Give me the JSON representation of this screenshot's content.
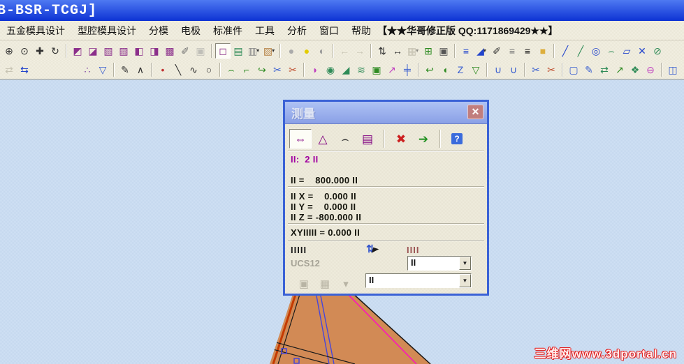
{
  "window": {
    "title": "B-BSR-TCGJ]"
  },
  "menu": {
    "items": [
      {
        "name": "menu-hardware-mold-design",
        "label": "五金模具设计"
      },
      {
        "name": "menu-cavity-mold-design",
        "label": "型腔模具设计"
      },
      {
        "name": "menu-parting",
        "label": "分模"
      },
      {
        "name": "menu-electrode",
        "label": "电极"
      },
      {
        "name": "menu-standard-parts",
        "label": "标准件"
      },
      {
        "name": "menu-tools",
        "label": "工具"
      },
      {
        "name": "menu-analysis",
        "label": "分析"
      },
      {
        "name": "menu-window",
        "label": "窗口"
      },
      {
        "name": "menu-help",
        "label": "帮助"
      }
    ],
    "banner": "【★★华哥修正版 QQ:1171869429★★】"
  },
  "toolbars": {
    "row1": [
      {
        "name": "zoom-window-icon",
        "glyph": "⊕",
        "color": "#303030"
      },
      {
        "name": "zoom-icon",
        "glyph": "⊙",
        "color": "#303030"
      },
      {
        "name": "pan-icon",
        "glyph": "✚",
        "color": "#303030"
      },
      {
        "name": "rotate-view-icon",
        "glyph": "↻",
        "color": "#303030"
      },
      {
        "sep": true
      },
      {
        "name": "shaded-view-icon",
        "glyph": "◩",
        "color": "#8B2F8B"
      },
      {
        "name": "isometric-view-icon",
        "glyph": "◪",
        "color": "#8B2F8B"
      },
      {
        "name": "trimetric-view-icon",
        "glyph": "▧",
        "color": "#8B2F8B"
      },
      {
        "name": "top-view-icon",
        "glyph": "▨",
        "color": "#8B2F8B"
      },
      {
        "name": "front-view-icon",
        "glyph": "◧",
        "color": "#8B2F8B"
      },
      {
        "name": "right-view-icon",
        "glyph": "◨",
        "color": "#8B2F8B"
      },
      {
        "name": "back-view-icon",
        "glyph": "▩",
        "color": "#8B2F8B"
      },
      {
        "name": "edit-view-icon",
        "glyph": "✐",
        "color": "#707070"
      },
      {
        "name": "lock-view-icon",
        "glyph": "▣",
        "color": "#9A9A9A",
        "grayed": true
      },
      {
        "sep": true
      },
      {
        "name": "shaded-display-icon",
        "glyph": "◻",
        "color": "#8B2F8B",
        "pressed": true
      },
      {
        "name": "wireframe-display-icon",
        "glyph": "▤",
        "color": "#2E8B57"
      },
      {
        "name": "hidden-edges-icon",
        "glyph": "▥",
        "color": "#8A8A8A",
        "dropdown": true
      },
      {
        "name": "section-display-icon",
        "glyph": "▧",
        "color": "#B8864B",
        "dropdown": true
      },
      {
        "sep": true
      },
      {
        "name": "highlight-off-icon",
        "glyph": "●",
        "color": "#AAAAAA"
      },
      {
        "name": "highlight-on-icon",
        "glyph": "●",
        "color": "#E3CC00"
      },
      {
        "name": "highlight-pick-icon",
        "glyph": "◐",
        "color": "#999999"
      },
      {
        "sep": true
      },
      {
        "name": "undo-view-icon",
        "glyph": "←",
        "color": "#A9A593",
        "grayed": true
      },
      {
        "name": "redo-view-icon",
        "glyph": "→",
        "color": "#A9A593",
        "grayed": true
      },
      {
        "sep": true
      },
      {
        "name": "swap-window-icon",
        "glyph": "⇅",
        "color": "#303030"
      },
      {
        "name": "measure-tool-icon",
        "glyph": "↔",
        "color": "#303030"
      },
      {
        "name": "pattern-icon",
        "glyph": "▦",
        "color": "#A9A593",
        "grayed": true,
        "dropdown": true
      },
      {
        "name": "new-part-icon",
        "glyph": "⊞",
        "color": "#2E8B22"
      },
      {
        "name": "part-navigator-icon",
        "glyph": "▣",
        "color": "#555555"
      },
      {
        "sep": true
      },
      {
        "name": "layer-settings-icon",
        "glyph": "≡",
        "color": "#2244CC"
      },
      {
        "name": "object-color-icon",
        "glyph": "◢",
        "color": "#2244CC",
        "dropdown": true
      },
      {
        "name": "eyedropper-icon",
        "glyph": "✐",
        "color": "#303030"
      },
      {
        "name": "line-style-icon",
        "glyph": "≡",
        "color": "#777777"
      },
      {
        "name": "line-width-icon",
        "glyph": "≡",
        "color": "#111111"
      },
      {
        "name": "material-icon",
        "glyph": "■",
        "color": "#DDAE3C"
      },
      {
        "sep": true
      },
      {
        "name": "line-tool-icon",
        "glyph": "╱",
        "color": "#2244CC"
      },
      {
        "name": "polyline-tool-icon",
        "glyph": "╱",
        "color": "#2E8B57"
      },
      {
        "name": "circle-tool-icon",
        "glyph": "◎",
        "color": "#2244CC"
      },
      {
        "name": "arc-tool-icon",
        "glyph": "⌢",
        "color": "#2E8B57"
      },
      {
        "name": "chamfer-tool-icon",
        "glyph": "▱",
        "color": "#2244CC"
      },
      {
        "name": "trim-tool-icon",
        "glyph": "✕",
        "color": "#2244CC"
      },
      {
        "name": "divide-tool-icon",
        "glyph": "⊘",
        "color": "#2E8B57"
      }
    ],
    "row2": [
      {
        "name": "transform-icon",
        "glyph": "⇄",
        "color": "#A9A593",
        "grayed": true
      },
      {
        "name": "reorder-icon",
        "glyph": "⇆",
        "color": "#2244CC"
      },
      {
        "gap": 68
      },
      {
        "name": "point-constructor-icon",
        "glyph": "∴",
        "color": "#7A3FA0"
      },
      {
        "name": "selection-filter-icon",
        "glyph": "▽",
        "color": "#3A5FD0"
      },
      {
        "sep": true
      },
      {
        "name": "sketch-icon",
        "glyph": "✎",
        "color": "#303030"
      },
      {
        "name": "profile-icon",
        "glyph": "∧",
        "color": "#303030"
      },
      {
        "sep": true
      },
      {
        "name": "point-icon",
        "glyph": "•",
        "color": "#C03030"
      },
      {
        "name": "line-icon",
        "glyph": "╲",
        "color": "#303030"
      },
      {
        "name": "spline-icon",
        "glyph": "∿",
        "color": "#303030"
      },
      {
        "name": "circle-icon",
        "glyph": "○",
        "color": "#303030"
      },
      {
        "sep": true
      },
      {
        "name": "bridge-curve-icon",
        "glyph": "⌢",
        "color": "#2E8B22"
      },
      {
        "name": "corner-curve-icon",
        "glyph": "⌐",
        "color": "#2E8B22"
      },
      {
        "name": "extend-curve-icon",
        "glyph": "↪",
        "color": "#2E8B22"
      },
      {
        "name": "trim-curve-icon",
        "glyph": "✂",
        "color": "#3A5FD0"
      },
      {
        "name": "break-curve-icon",
        "glyph": "✂",
        "color": "#C05030"
      },
      {
        "sep": true
      },
      {
        "name": "swept-surface-icon",
        "glyph": "◗",
        "color": "#C040C0"
      },
      {
        "name": "sphere-surface-icon",
        "glyph": "◉",
        "color": "#2E8B57"
      },
      {
        "name": "ruled-surface-icon",
        "glyph": "◢",
        "color": "#2E8B57"
      },
      {
        "name": "ripple-surface-icon",
        "glyph": "≋",
        "color": "#2E8B57"
      },
      {
        "name": "bounded-plane-icon",
        "glyph": "▣",
        "color": "#2E8B22"
      },
      {
        "name": "datum-axis-icon",
        "glyph": "↗",
        "color": "#C040C0"
      },
      {
        "name": "tube-icon",
        "glyph": "╪",
        "color": "#3A5FD0"
      },
      {
        "sep": true
      },
      {
        "name": "flange-icon",
        "glyph": "↩",
        "color": "#2E8B22"
      },
      {
        "name": "revolve-icon",
        "glyph": "◖",
        "color": "#2E8B22"
      },
      {
        "name": "loft-icon",
        "glyph": "Z",
        "color": "#3A5FD0"
      },
      {
        "name": "funnel-surface-icon",
        "glyph": "▽",
        "color": "#2E8B22"
      },
      {
        "sep": true
      },
      {
        "name": "shell-icon",
        "glyph": "∪",
        "color": "#3A5FD0"
      },
      {
        "name": "shell-pattern-icon",
        "glyph": "∪",
        "color": "#3A5FD0"
      },
      {
        "sep": true
      },
      {
        "name": "trim-sheet-icon",
        "glyph": "✂",
        "color": "#3A5FD0"
      },
      {
        "name": "split-sheet-icon",
        "glyph": "✂",
        "color": "#C05030"
      },
      {
        "sep": true
      },
      {
        "name": "move-object-icon",
        "glyph": "▢",
        "color": "#3A5FD0"
      },
      {
        "name": "edit-object-icon",
        "glyph": "✎",
        "color": "#3A5FD0"
      },
      {
        "name": "swap-faces-icon",
        "glyph": "⇄",
        "color": "#2E8B57"
      },
      {
        "name": "offset-face-icon",
        "glyph": "↗",
        "color": "#2E8B22"
      },
      {
        "name": "deform-icon",
        "glyph": "❖",
        "color": "#2E8B57"
      },
      {
        "name": "sew-icon",
        "glyph": "⊖",
        "color": "#C040C0"
      },
      {
        "sep": true
      },
      {
        "name": "extract-icon",
        "glyph": "◫",
        "color": "#3A5FD0"
      }
    ]
  },
  "dialog": {
    "title": "测量",
    "close_glyph": "✕",
    "toolbar": [
      {
        "name": "measure-distance-tab",
        "glyph": "⇔",
        "color": "#800080",
        "pressed": true
      },
      {
        "name": "measure-angle-tab",
        "glyph": "△",
        "color": "#800080"
      },
      {
        "name": "measure-radius-tab",
        "glyph": "⌢",
        "color": "#303030"
      },
      {
        "name": "measure-list-tab",
        "glyph": "▤",
        "color": "#800080"
      },
      {
        "sep": true
      },
      {
        "name": "clear-measure-button",
        "glyph": "✖",
        "color": "#CC2020"
      },
      {
        "name": "export-measure-button",
        "glyph": "➔",
        "color": "#209020"
      },
      {
        "sep": true
      },
      {
        "name": "measure-help-button",
        "glyph": "?",
        "bg": true
      }
    ],
    "readouts": {
      "count_line": "II:  2 II",
      "distance_line": "II =    800.000 II",
      "dx_line": "II X =    0.000 II",
      "dy_line": "II Y =    0.000 II",
      "dz_line": "II Z = -800.000 II",
      "xy_line": "XYIIIII = 0.000 II"
    },
    "info_left": "IIIII",
    "info_right": "IIII",
    "snap_arrows_glyph": "⇅",
    "snap_pointer_glyph": "◤",
    "ucs_label": "UCS12",
    "combo1_value": "II",
    "combo2_value": "II",
    "footer_icons": [
      {
        "name": "image-capture-icon",
        "glyph": "▣"
      },
      {
        "name": "stamp-icon",
        "glyph": "▦"
      },
      {
        "name": "more-options-icon",
        "glyph": "▾"
      }
    ]
  },
  "icons": {
    "dropdown_arrow": "▼"
  },
  "watermark": {
    "text": "三维网www.3dportal.cn"
  },
  "colors": {
    "titlebar-top": "#4E79F2",
    "titlebar-bottom": "#0D32D4",
    "viewport-bg": "#CADCF1",
    "dialog-border": "#3B62D6",
    "dialog-title-top": "#AEC2F4",
    "dialog-title-bottom": "#8AA0E6",
    "close-bg": "#C17E7E",
    "accent-magenta": "#A000A0",
    "text-dark": "#15150D",
    "label-brown": "#9B5454",
    "label-gray": "#A6A396",
    "help-blue": "#3A6BDC",
    "watermark-red": "#E02020",
    "model-fill": "#D28A55",
    "model-edge-blue": "#4646DC",
    "model-edge-magenta": "#FF10C0",
    "model-stripe": "#C43A00"
  }
}
